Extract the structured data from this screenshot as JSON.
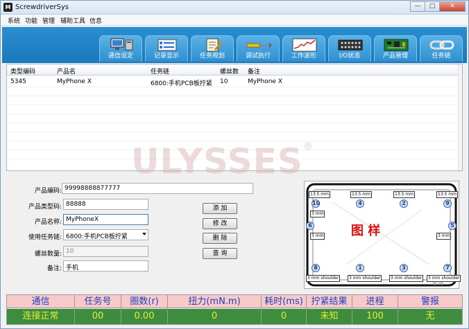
{
  "window": {
    "title": "ScrewdriverSys",
    "icon_text": "M",
    "min": "—",
    "max": "□",
    "close": "✕"
  },
  "menu": [
    "系统",
    "功能",
    "管理",
    "辅助工具",
    "信息"
  ],
  "tabs": [
    {
      "label": "通信设定",
      "icon": "monitor-computer-icon"
    },
    {
      "label": "记录显示",
      "icon": "list-record-icon"
    },
    {
      "label": "任务规划",
      "icon": "notepad-pencil-icon"
    },
    {
      "label": "调试执行",
      "icon": "screwdriver-icon"
    },
    {
      "label": "工作波形",
      "icon": "waveform-chart-icon"
    },
    {
      "label": "I/O状态",
      "icon": "io-panel-icon"
    },
    {
      "label": "产品管理",
      "icon": "pcb-board-icon"
    },
    {
      "label": "任务链",
      "icon": "chain-link-icon"
    }
  ],
  "table": {
    "headers": [
      "类型编码",
      "产品名",
      "任务链",
      "螺丝数",
      "备注"
    ],
    "rows": [
      [
        "5345",
        "MyPhone X",
        "6800:手机PCB板拧紧",
        "10",
        "MyPhone X"
      ]
    ]
  },
  "watermark": {
    "text": "ULYSSES",
    "mark": "®"
  },
  "form": {
    "product_code_label": "产品编码:",
    "product_code_value": "99998888877777",
    "type_code_label": "产品类型码:",
    "type_code_value": "88888",
    "product_name_label": "产品名称:",
    "product_name_value": "MyPhoneX",
    "task_chain_label": "使用任务链:",
    "task_chain_value": "6800:手机PCB板拧紧",
    "screw_count_label": "螺丝数量:",
    "screw_count_value": "10",
    "remark_label": "备注:",
    "remark_value": "手机"
  },
  "buttons": {
    "add": "添 加",
    "edit": "修 改",
    "delete": "删 除",
    "query": "查 询"
  },
  "diagram": {
    "caption": "图  样",
    "screws": [
      {
        "n": "10",
        "label": "3 mm"
      },
      {
        "n": "4",
        "label": "13.5 mm"
      },
      {
        "n": "2",
        "label": "13.5 mm"
      },
      {
        "n": "9",
        "label": "13.5 mm"
      },
      {
        "n": "6",
        "label": "3 mm"
      },
      {
        "n": "5",
        "label": "3 mm"
      },
      {
        "n": "8",
        "label": "3 mm shoulder"
      },
      {
        "n": "1",
        "label": "3 mm shoulder"
      },
      {
        "n": "3",
        "label": "3 mm shoulder"
      },
      {
        "n": "7",
        "label": "3 mm shoulder"
      }
    ],
    "top_label_1": "13.5 mm",
    "corner_mark": "值 得"
  },
  "status": {
    "headers": [
      "通信",
      "任务号",
      "圈数(r)",
      "扭力(mN.m)",
      "耗时(ms)",
      "拧紧结果",
      "进程",
      "警报"
    ],
    "values": [
      "连接正常",
      "00",
      "0.00",
      "0",
      "0",
      "未知",
      "100",
      "无"
    ]
  },
  "colors": {
    "ribbon": "#1f82c6",
    "status_header": "#f7c9c9",
    "status_value_bg": "#3e8c3e",
    "status_value_fg": "#e4ee34",
    "caption_red": "#e01010"
  }
}
